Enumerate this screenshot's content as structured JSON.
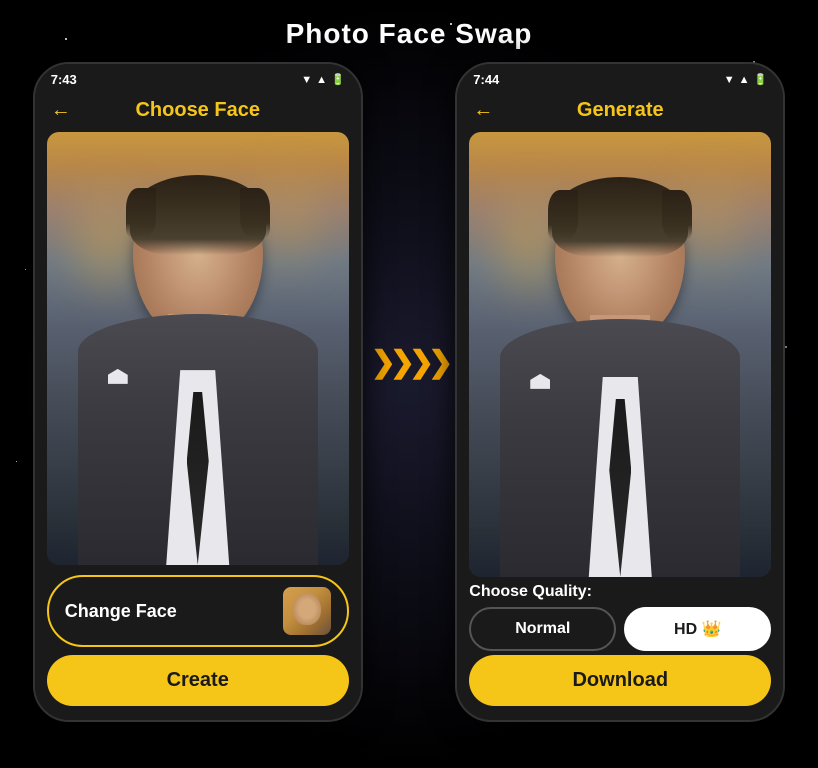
{
  "page": {
    "title": "Photo Face Swap",
    "background_color": "#000"
  },
  "left_phone": {
    "status_time": "7:43",
    "header_back": "←",
    "header_title": "Choose Face",
    "change_face_label": "Change Face",
    "create_label": "Create"
  },
  "right_phone": {
    "status_time": "7:44",
    "header_back": "←",
    "header_title": "Generate",
    "quality_section_label": "Choose Quality:",
    "quality_normal_label": "Normal",
    "quality_hd_label": "HD 👑",
    "download_label": "Download"
  },
  "arrow": {
    "symbol": "❯❯❯❯"
  }
}
